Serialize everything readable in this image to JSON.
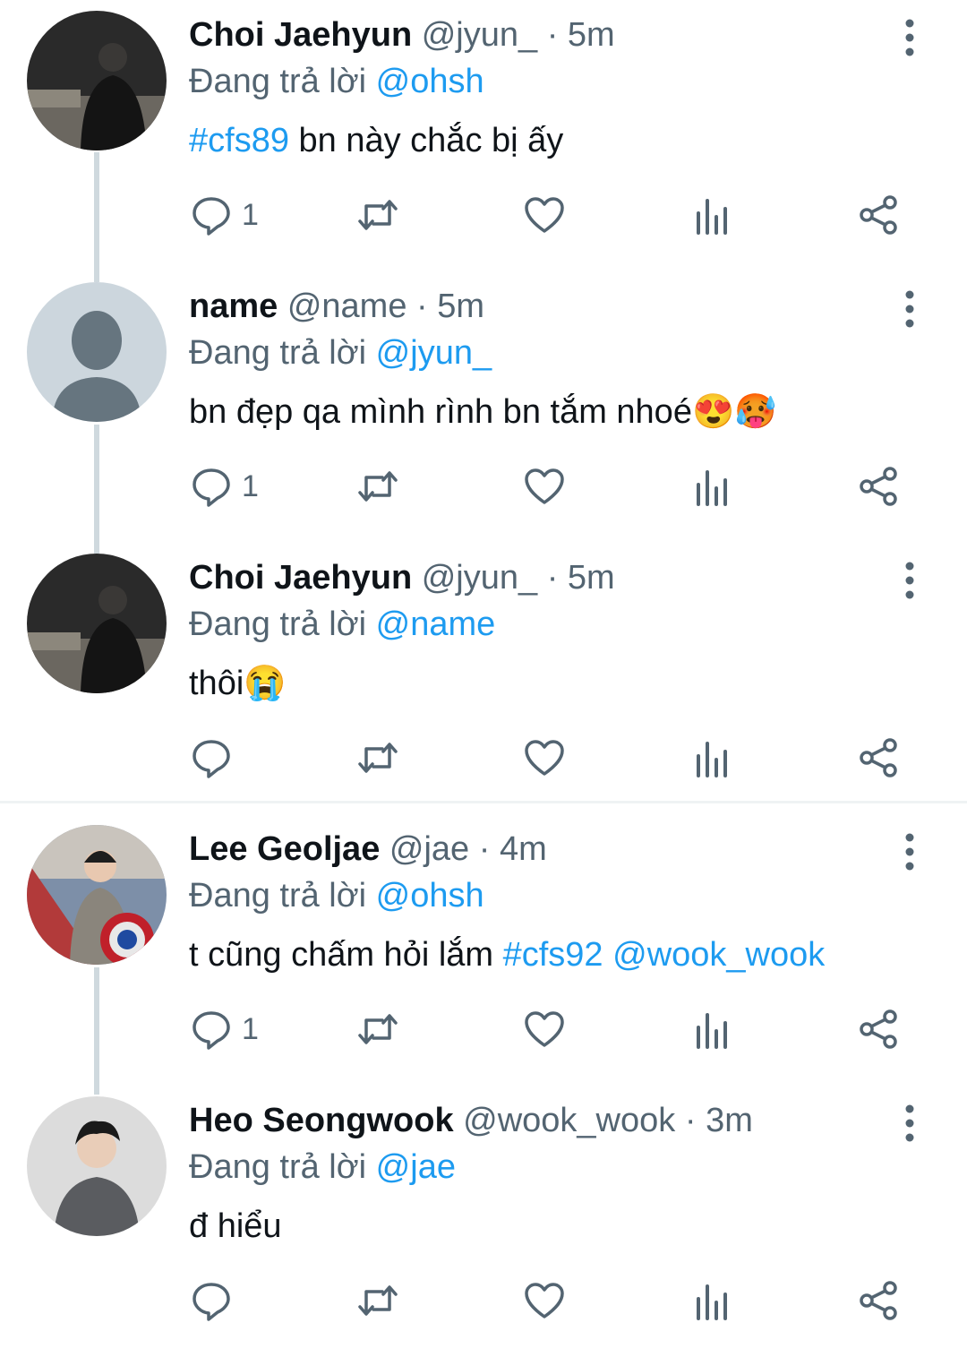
{
  "replying_label": "Đang trả lời",
  "colors": {
    "accent": "#1d9bf0",
    "secondary_text": "#536471",
    "thread_line": "#cfd9de"
  },
  "tweets": [
    {
      "name": "Choi Jaehyun",
      "handle": "@jyun_",
      "time": "5m",
      "replying_to": "@ohsh",
      "body_parts": [
        {
          "text": "#cfs89",
          "link": true
        },
        {
          "text": " bn này chắc bị ấy",
          "link": false
        }
      ],
      "reply_count": "1",
      "avatar": "dark-photo-avatar"
    },
    {
      "name": "name",
      "handle": "@name",
      "time": "5m",
      "replying_to": "@jyun_",
      "body_parts": [
        {
          "text": "bn đẹp qa mình rình bn tắm nhoé😍🥵",
          "link": false
        }
      ],
      "reply_count": "1",
      "avatar": "default-avatar"
    },
    {
      "name": "Choi Jaehyun",
      "handle": "@jyun_",
      "time": "5m",
      "replying_to": "@name",
      "body_parts": [
        {
          "text": "thôi😭",
          "link": false
        }
      ],
      "reply_count": "",
      "avatar": "dark-photo-avatar"
    },
    {
      "name": "Lee Geoljae",
      "handle": "@jae",
      "time": "4m",
      "replying_to": "@ohsh",
      "body_parts": [
        {
          "text": "t cũng chấm hỏi lắm ",
          "link": false
        },
        {
          "text": "#cfs92",
          "link": true
        },
        {
          "text": " ",
          "link": false
        },
        {
          "text": "@wook_wook",
          "link": true
        }
      ],
      "reply_count": "1",
      "avatar": "shield-photo-avatar"
    },
    {
      "name": "Heo Seongwook",
      "handle": "@wook_wook",
      "time": "3m",
      "replying_to": "@jae",
      "body_parts": [
        {
          "text": "đ hiểu",
          "link": false
        }
      ],
      "reply_count": "",
      "avatar": "portrait-photo-avatar"
    }
  ]
}
